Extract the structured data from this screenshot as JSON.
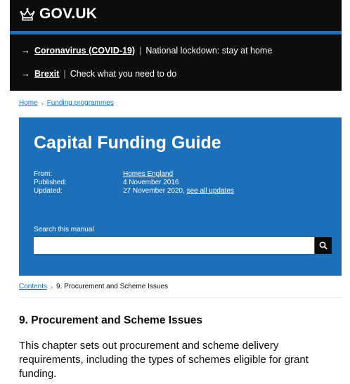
{
  "header": {
    "logo_text": "GOV.UK",
    "logo_icon": "crown-icon",
    "accent_color": "#1d70b8"
  },
  "notices": [
    {
      "link": "Coronavirus (COVID-19)",
      "text": "National lockdown: stay at home"
    },
    {
      "link": "Brexit",
      "text": "Check what you need to do"
    }
  ],
  "breadcrumb": [
    "Home",
    "Funding programmes"
  ],
  "hero": {
    "title": "Capital Funding Guide",
    "from_label": "From:",
    "from_value": "Homes England",
    "published_label": "Published:",
    "published_value": "4 November 2016",
    "updated_label": "Updated:",
    "updated_value": "27 November 2020,",
    "updates_link": "see all updates",
    "background_color": "#1d70b8"
  },
  "search": {
    "label": "Search this manual",
    "value": "",
    "button_icon": "search-icon"
  },
  "contents_bar": {
    "link": "Contents",
    "current": "9. Procurement and Scheme Issues"
  },
  "chapter": {
    "title": "9. Procurement and Scheme Issues",
    "description": "This chapter sets out procurement and scheme delivery requirements, including the types of schemes eligible for grant funding."
  }
}
